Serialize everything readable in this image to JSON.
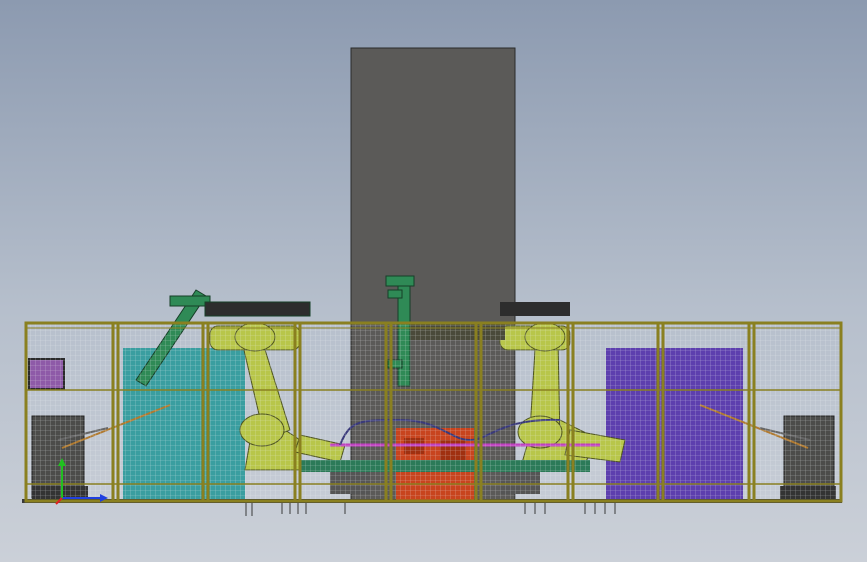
{
  "viewport": {
    "background_top": "#8c9ab0",
    "background_bottom": "#cbd0d8"
  },
  "model": {
    "tower_color": "#5b5a58",
    "fence_frame_color": "#8a8020",
    "fence_mesh_color": "#e8ecef",
    "robot_color": "#b8c64a",
    "gripper_color": "#2f8a56",
    "teal_panel_color": "#3a9ea0",
    "purple_panel_color": "#5d3fae",
    "red_fixture_color": "#c8441e",
    "small_display_color": "#8e5aa8",
    "conveyor_color": "#2c7a58"
  },
  "triad": {
    "x_axis_color": "#2040e0",
    "y_axis_color": "#20c020",
    "z_axis_color": "#e02020"
  }
}
